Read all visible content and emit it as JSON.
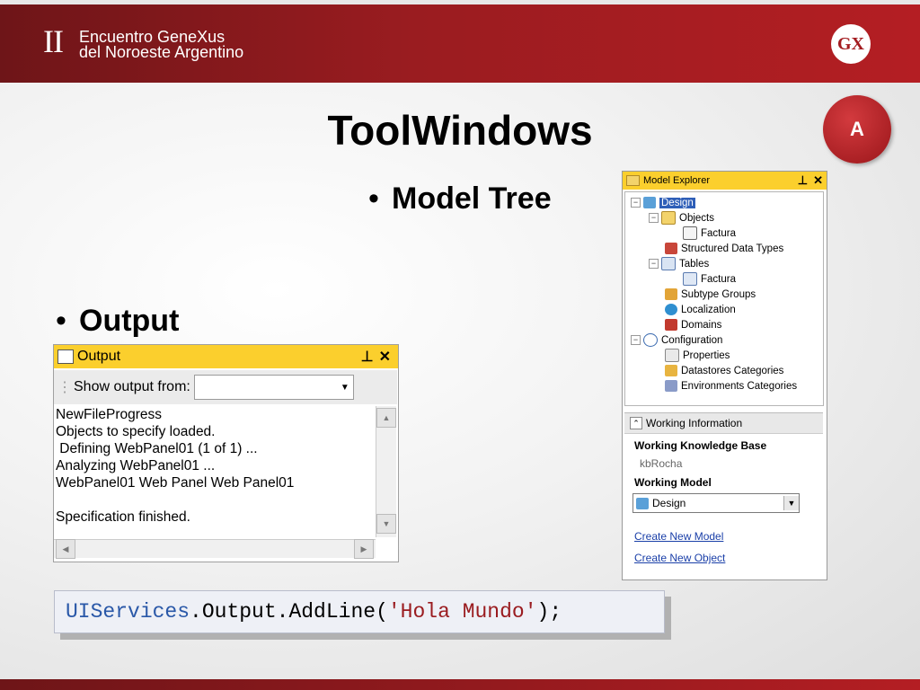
{
  "header": {
    "roman": "II",
    "event_line1": "Encuentro GeneXus",
    "event_line2": "del Noroeste Argentino",
    "logo_text": "GX"
  },
  "title": "ToolWindows",
  "badge": "A",
  "bullets": {
    "model_tree": "Model Tree",
    "output": "Output",
    "mark": "•"
  },
  "model_explorer": {
    "title": "Model Explorer",
    "pin": "⬆",
    "close": "✕",
    "tree": [
      {
        "label": "Design",
        "expander": "−",
        "icon": "design-icon",
        "selected": true
      },
      {
        "label": "Objects",
        "expander": "−",
        "icon": "folder-icon"
      },
      {
        "label": "Factura",
        "icon": "webpanel-icon"
      },
      {
        "label": "Structured Data Types",
        "icon": "sdt-icon"
      },
      {
        "label": "Tables",
        "expander": "−",
        "icon": "tables-icon"
      },
      {
        "label": "Factura",
        "icon": "table-icon"
      },
      {
        "label": "Subtype Groups",
        "icon": "subtype-icon"
      },
      {
        "label": "Localization",
        "icon": "globe-icon"
      },
      {
        "label": "Domains",
        "icon": "domains-icon"
      },
      {
        "label": "Configuration",
        "expander": "−",
        "icon": "info-icon"
      },
      {
        "label": "Properties",
        "icon": "properties-icon"
      },
      {
        "label": "Datastores Categories",
        "icon": "datastores-icon"
      },
      {
        "label": "Environments Categories",
        "icon": "environments-icon"
      }
    ]
  },
  "working_info": {
    "header": "Working Information",
    "kb_label": "Working Knowledge Base",
    "kb_value": "kbRocha",
    "model_label": "Working Model",
    "model_value": "Design",
    "link_new_model": "Create New Model",
    "link_new_object": "Create New Object"
  },
  "output": {
    "title": "Output",
    "show_from_label": "Show output from:",
    "show_from_value": "",
    "lines": [
      "NewFileProgress",
      "Objects to specify loaded.",
      " Defining WebPanel01 (1 of 1) ...",
      "Analyzing WebPanel01 ...",
      "WebPanel01 Web Panel Web Panel01",
      "",
      "Specification finished."
    ]
  },
  "code": {
    "part1": "UIServices",
    "part2": ".Output.AddLine(",
    "part3": "'Hola Mundo'",
    "part4": ");"
  },
  "colors": {
    "brand_red": "#9a1c20",
    "panel_header_yellow": "#fbcf2d",
    "selection_blue": "#2f5fb8",
    "code_blue": "#2a58a8"
  }
}
